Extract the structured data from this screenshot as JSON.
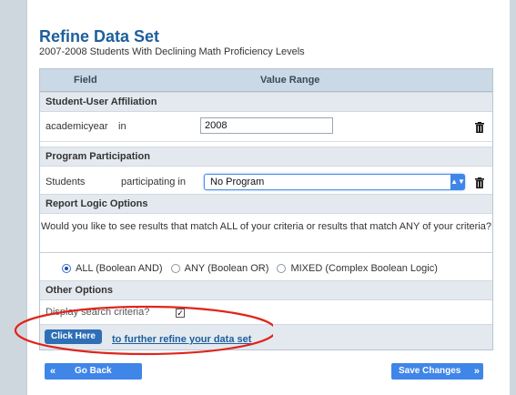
{
  "title": "Refine Data Set",
  "subtitle": "2007-2008 Students With Declining Math Proficiency Levels",
  "table": {
    "header_field": "Field",
    "header_value": "Value Range"
  },
  "student_affiliation": {
    "section": "Student-User Affiliation",
    "field": "academicyear",
    "operator": "in",
    "value": "2008"
  },
  "program": {
    "section": "Program Participation",
    "field": "Students",
    "operator": "participating in",
    "selected": "No Program"
  },
  "logic": {
    "section": "Report Logic Options",
    "question": "Would you like to see results that match ALL of your criteria or results that match ANY of your criteria?",
    "options": [
      "ALL (Boolean AND)",
      "ANY (Boolean OR)",
      "MIXED (Complex Boolean Logic)"
    ],
    "selected": "ALL (Boolean AND)"
  },
  "other": {
    "section": "Other Options",
    "display_label": "Display search criteria?",
    "display_checked": true
  },
  "refine": {
    "button": "Click Here",
    "link": "to further refine your data set"
  },
  "nav": {
    "back": "Go Back",
    "save": "Save Changes"
  },
  "icons": {
    "delete": "trash-icon",
    "back": "double-chevron-left-icon",
    "save": "double-chevron-right-icon"
  },
  "colors": {
    "title": "#1d5f9c",
    "button": "#3f86e8",
    "highlight_ellipse": "#e0251b"
  }
}
